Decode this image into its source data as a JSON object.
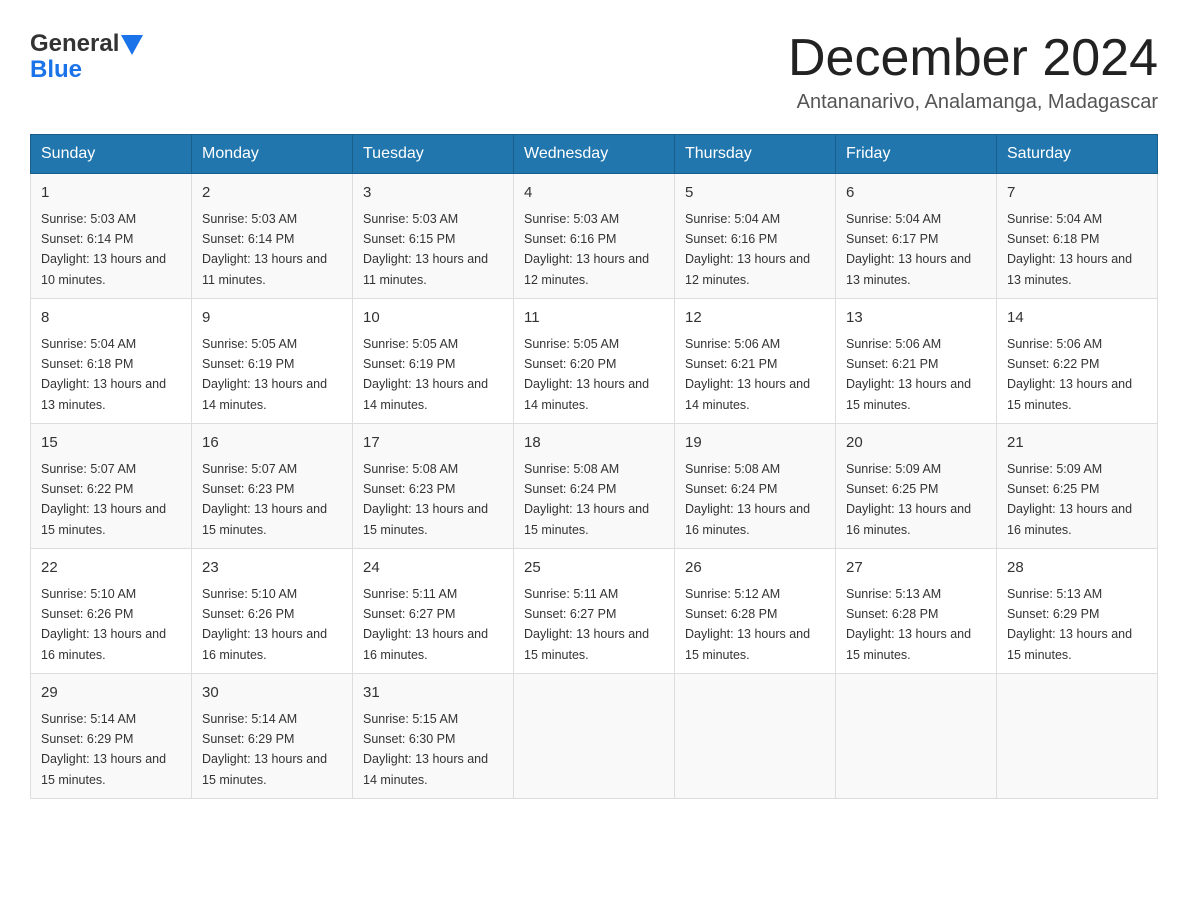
{
  "header": {
    "title": "December 2024",
    "subtitle": "Antananarivo, Analamanga, Madagascar",
    "logo_general": "General",
    "logo_blue": "Blue"
  },
  "columns": [
    "Sunday",
    "Monday",
    "Tuesday",
    "Wednesday",
    "Thursday",
    "Friday",
    "Saturday"
  ],
  "weeks": [
    [
      {
        "day": "1",
        "sunrise": "5:03 AM",
        "sunset": "6:14 PM",
        "daylight": "13 hours and 10 minutes."
      },
      {
        "day": "2",
        "sunrise": "5:03 AM",
        "sunset": "6:14 PM",
        "daylight": "13 hours and 11 minutes."
      },
      {
        "day": "3",
        "sunrise": "5:03 AM",
        "sunset": "6:15 PM",
        "daylight": "13 hours and 11 minutes."
      },
      {
        "day": "4",
        "sunrise": "5:03 AM",
        "sunset": "6:16 PM",
        "daylight": "13 hours and 12 minutes."
      },
      {
        "day": "5",
        "sunrise": "5:04 AM",
        "sunset": "6:16 PM",
        "daylight": "13 hours and 12 minutes."
      },
      {
        "day": "6",
        "sunrise": "5:04 AM",
        "sunset": "6:17 PM",
        "daylight": "13 hours and 13 minutes."
      },
      {
        "day": "7",
        "sunrise": "5:04 AM",
        "sunset": "6:18 PM",
        "daylight": "13 hours and 13 minutes."
      }
    ],
    [
      {
        "day": "8",
        "sunrise": "5:04 AM",
        "sunset": "6:18 PM",
        "daylight": "13 hours and 13 minutes."
      },
      {
        "day": "9",
        "sunrise": "5:05 AM",
        "sunset": "6:19 PM",
        "daylight": "13 hours and 14 minutes."
      },
      {
        "day": "10",
        "sunrise": "5:05 AM",
        "sunset": "6:19 PM",
        "daylight": "13 hours and 14 minutes."
      },
      {
        "day": "11",
        "sunrise": "5:05 AM",
        "sunset": "6:20 PM",
        "daylight": "13 hours and 14 minutes."
      },
      {
        "day": "12",
        "sunrise": "5:06 AM",
        "sunset": "6:21 PM",
        "daylight": "13 hours and 14 minutes."
      },
      {
        "day": "13",
        "sunrise": "5:06 AM",
        "sunset": "6:21 PM",
        "daylight": "13 hours and 15 minutes."
      },
      {
        "day": "14",
        "sunrise": "5:06 AM",
        "sunset": "6:22 PM",
        "daylight": "13 hours and 15 minutes."
      }
    ],
    [
      {
        "day": "15",
        "sunrise": "5:07 AM",
        "sunset": "6:22 PM",
        "daylight": "13 hours and 15 minutes."
      },
      {
        "day": "16",
        "sunrise": "5:07 AM",
        "sunset": "6:23 PM",
        "daylight": "13 hours and 15 minutes."
      },
      {
        "day": "17",
        "sunrise": "5:08 AM",
        "sunset": "6:23 PM",
        "daylight": "13 hours and 15 minutes."
      },
      {
        "day": "18",
        "sunrise": "5:08 AM",
        "sunset": "6:24 PM",
        "daylight": "13 hours and 15 minutes."
      },
      {
        "day": "19",
        "sunrise": "5:08 AM",
        "sunset": "6:24 PM",
        "daylight": "13 hours and 16 minutes."
      },
      {
        "day": "20",
        "sunrise": "5:09 AM",
        "sunset": "6:25 PM",
        "daylight": "13 hours and 16 minutes."
      },
      {
        "day": "21",
        "sunrise": "5:09 AM",
        "sunset": "6:25 PM",
        "daylight": "13 hours and 16 minutes."
      }
    ],
    [
      {
        "day": "22",
        "sunrise": "5:10 AM",
        "sunset": "6:26 PM",
        "daylight": "13 hours and 16 minutes."
      },
      {
        "day": "23",
        "sunrise": "5:10 AM",
        "sunset": "6:26 PM",
        "daylight": "13 hours and 16 minutes."
      },
      {
        "day": "24",
        "sunrise": "5:11 AM",
        "sunset": "6:27 PM",
        "daylight": "13 hours and 16 minutes."
      },
      {
        "day": "25",
        "sunrise": "5:11 AM",
        "sunset": "6:27 PM",
        "daylight": "13 hours and 15 minutes."
      },
      {
        "day": "26",
        "sunrise": "5:12 AM",
        "sunset": "6:28 PM",
        "daylight": "13 hours and 15 minutes."
      },
      {
        "day": "27",
        "sunrise": "5:13 AM",
        "sunset": "6:28 PM",
        "daylight": "13 hours and 15 minutes."
      },
      {
        "day": "28",
        "sunrise": "5:13 AM",
        "sunset": "6:29 PM",
        "daylight": "13 hours and 15 minutes."
      }
    ],
    [
      {
        "day": "29",
        "sunrise": "5:14 AM",
        "sunset": "6:29 PM",
        "daylight": "13 hours and 15 minutes."
      },
      {
        "day": "30",
        "sunrise": "5:14 AM",
        "sunset": "6:29 PM",
        "daylight": "13 hours and 15 minutes."
      },
      {
        "day": "31",
        "sunrise": "5:15 AM",
        "sunset": "6:30 PM",
        "daylight": "13 hours and 14 minutes."
      },
      null,
      null,
      null,
      null
    ]
  ],
  "sunrise_label": "Sunrise: ",
  "sunset_label": "Sunset: ",
  "daylight_label": "Daylight: "
}
